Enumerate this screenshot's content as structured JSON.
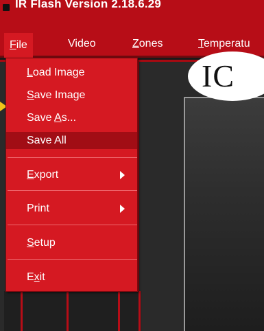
{
  "window": {
    "title": "IR Flash Version 2.18.6.29"
  },
  "menubar": {
    "items": [
      {
        "label": "File",
        "mnemonic": "F"
      },
      {
        "label": "Video"
      },
      {
        "label": "Zones",
        "mnemonic": "Z"
      },
      {
        "label": "Temperatu",
        "mnemonic": "T"
      }
    ]
  },
  "file_menu": {
    "items": [
      {
        "label": "Load Image",
        "mnemonic": "L"
      },
      {
        "label": "Save Image",
        "mnemonic": "S"
      },
      {
        "label": "Save As...",
        "mnemonic": "A"
      },
      {
        "label": "Save All",
        "highlighted": true
      },
      {
        "label": "Export",
        "mnemonic": "E",
        "has_submenu": true
      },
      {
        "label": "Print",
        "has_submenu": true
      },
      {
        "label": "Setup",
        "mnemonic": "S"
      },
      {
        "label": "Exit",
        "mnemonic": "x"
      }
    ]
  },
  "workspace": {
    "logo_text": "IC"
  },
  "colors": {
    "menu_background": "#d51922",
    "titlebar": "#b70d17",
    "highlight": "#a10d15",
    "separator": "#ef6a70"
  }
}
